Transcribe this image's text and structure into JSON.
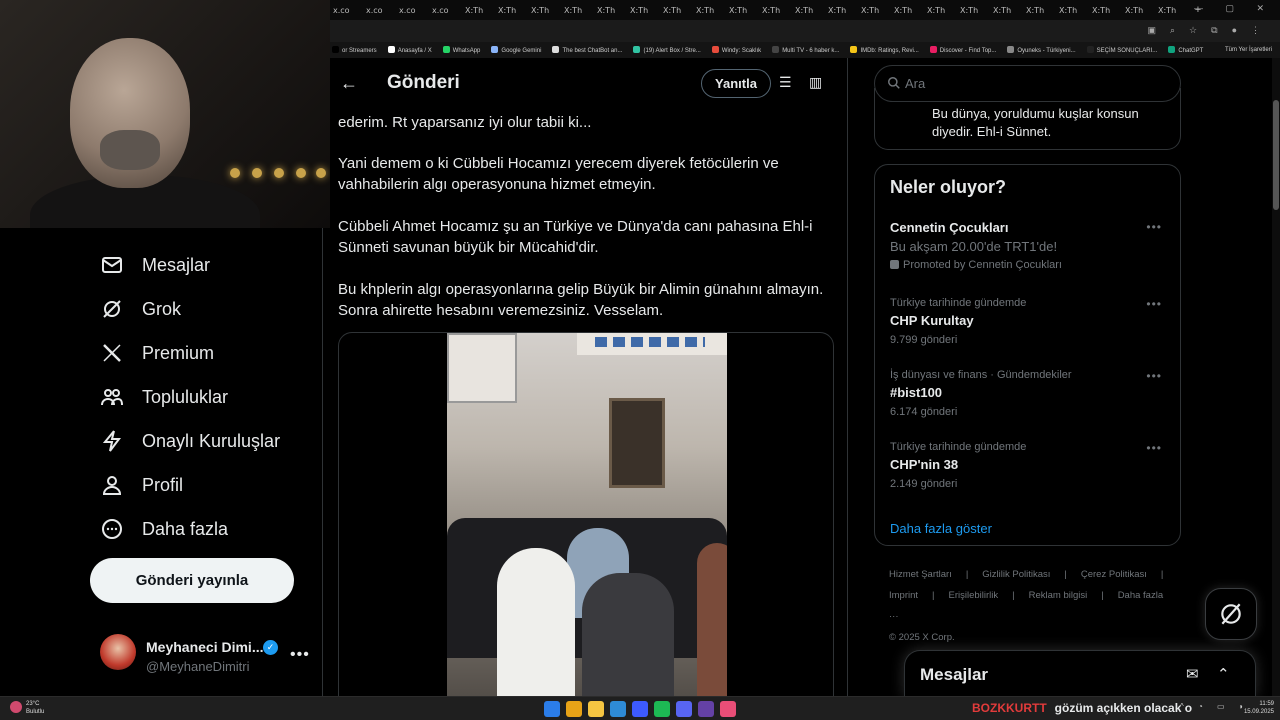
{
  "browser": {
    "tabs": [
      "x.co",
      "x.co",
      "x.co",
      "x.co",
      "X:Th",
      "X:Th",
      "X:Th",
      "X:Th",
      "X:Th",
      "X:Th",
      "X:Th",
      "X:Th",
      "X:Th",
      "X:Th",
      "X:Th",
      "X:Th",
      "X:Th",
      "X:Th",
      "X:Th",
      "X:Th",
      "X:Th",
      "X:Th",
      "X:Th",
      "X:Th",
      "X:Th",
      "X:Th"
    ],
    "new_tab": "+",
    "bookmarks": [
      {
        "label": "or Streamers",
        "color": "#000000"
      },
      {
        "label": "Anasayfa / X",
        "color": "#ffffff"
      },
      {
        "label": "WhatsApp",
        "color": "#25d366"
      },
      {
        "label": "Google Gemini",
        "color": "#8ab4f8"
      },
      {
        "label": "The best ChatBot an...",
        "color": "#dddddd"
      },
      {
        "label": "(19) Alert Box / Stre...",
        "color": "#31c3a2"
      },
      {
        "label": "Windy: Scaklık",
        "color": "#e74c3c"
      },
      {
        "label": "Multi TV - 6 haber k...",
        "color": "#444444"
      },
      {
        "label": "IMDb: Ratings, Revi...",
        "color": "#f5c518"
      },
      {
        "label": "Discover - Find Top...",
        "color": "#e91e63"
      },
      {
        "label": "Oyuneks - Türkiyeni...",
        "color": "#888888"
      },
      {
        "label": "SEÇİM SONUÇLARI...",
        "color": "#222222"
      },
      {
        "label": "ChatGPT",
        "color": "#10a37f"
      }
    ],
    "all_bookmarks": "Tüm Yer İşaretleri"
  },
  "nav": {
    "items": [
      {
        "label": "Mesajlar",
        "icon": "mail-icon"
      },
      {
        "label": "Grok",
        "icon": "grok-icon"
      },
      {
        "label": "Premium",
        "icon": "x-logo-icon"
      },
      {
        "label": "Topluluklar",
        "icon": "communities-icon"
      },
      {
        "label": "Onaylı Kuruluşlar",
        "icon": "lightning-icon"
      },
      {
        "label": "Profil",
        "icon": "person-icon"
      },
      {
        "label": "Daha fazla",
        "icon": "more-circle-icon"
      }
    ],
    "post_button": "Gönderi yayınla",
    "profile": {
      "name": "Meyhaneci Dimi...",
      "handle": "@MeyhaneDimitri",
      "more": "•••"
    }
  },
  "main": {
    "title": "Gönderi",
    "reply_button": "Yanıtla",
    "paragraphs": [
      "ederim. Rt yaparsanız iyi olur tabii ki...",
      "Yani demem o ki Cübbeli Hocamızı yerecem diyerek fetöcülerin ve vahhabilerin algı operasyonuna hizmet etmeyin.",
      "Cübbeli Ahmet Hocamız şu an Türkiye ve Dünya'da canı pahasına Ehl-i Sünneti savunan büyük bir Mücahid'dir.",
      "Bu khplerin algı operasyonlarına gelip Büyük bir Alimin günahını almayın. Sonra ahirette hesabını veremezsiniz. Vesselam."
    ]
  },
  "right": {
    "search_placeholder": "Ara",
    "prev_text": "Bu dünya, yoruldumu kuşlar konsun diyedir. Ehl-i Sünnet.",
    "trends_title": "Neler oluyor?",
    "promo": {
      "name": "Cennetin Çocukları",
      "sub": "Bu akşam 20.00'de TRT1'de!",
      "by": "Promoted by Cennetin Çocukları"
    },
    "trends": [
      {
        "meta": "Türkiye tarihinde gündemde",
        "name": "CHP Kurultay",
        "count": "9.799 gönderi"
      },
      {
        "meta": "İş dünyası ve finans · Gündemdekiler",
        "name": "#bist100",
        "count": "6.174 gönderi"
      },
      {
        "meta": "Türkiye tarihinde gündemde",
        "name": "CHP'nin 38",
        "count": "2.149 gönderi"
      }
    ],
    "more_dots": "•••",
    "show_more": "Daha fazla göster",
    "footer_line1": [
      "Hizmet Şartları",
      "Gizlilik Politikası",
      "Çerez Politikası"
    ],
    "footer_line2": [
      "Imprint",
      "Erişilebilirlik",
      "Reklam bilgisi",
      "Daha fazla ···"
    ],
    "copyright": "© 2025 X Corp."
  },
  "messages_drawer": {
    "title": "Mesajlar"
  },
  "taskbar": {
    "weather_temp": "23°C",
    "weather_desc": "Bulutlu",
    "ticker_brand": "BOZKKURTT",
    "ticker_text": "gözüm açıkken olacak o",
    "time": "11:59",
    "date": "15.09.2025",
    "apps": [
      "#2b7de9",
      "#e8a317",
      "#f5c542",
      "#2e8bd6",
      "#3d5afe",
      "#1db954",
      "#5865f2",
      "#6441a5",
      "#e94e77"
    ]
  },
  "colors": {
    "accent": "#1d9bf0",
    "background": "#000000",
    "text": "#e7e9ea",
    "muted": "#71767b"
  }
}
